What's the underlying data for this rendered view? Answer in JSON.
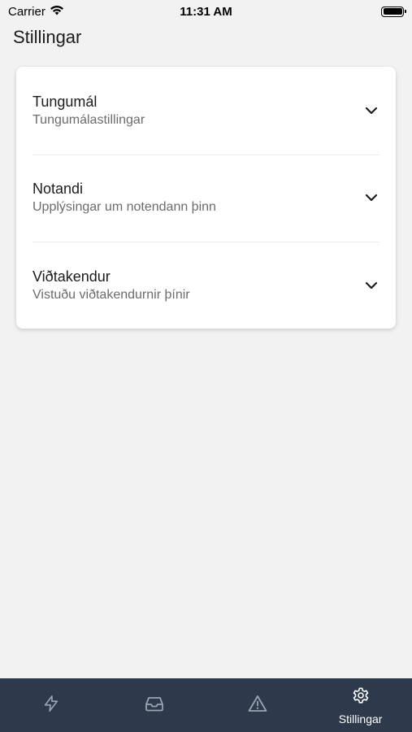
{
  "status_bar": {
    "carrier": "Carrier",
    "time": "11:31 AM"
  },
  "header": {
    "title": "Stillingar"
  },
  "settings": {
    "items": [
      {
        "title": "Tungumál",
        "subtitle": "Tungumálastillingar",
        "icon": "chevron-down-icon"
      },
      {
        "title": "Notandi",
        "subtitle": "Upplýsingar um notendann þinn",
        "icon": "chevron-down-icon"
      },
      {
        "title": "Viðtakendur",
        "subtitle": "Vistuðu viðtakendurnir þínir",
        "icon": "chevron-down-icon"
      }
    ]
  },
  "tab_bar": {
    "tabs": [
      {
        "icon": "lightning-icon",
        "label": ""
      },
      {
        "icon": "inbox-icon",
        "label": ""
      },
      {
        "icon": "warning-icon",
        "label": ""
      },
      {
        "icon": "gear-icon",
        "label": "Stillingar",
        "active": true
      }
    ]
  },
  "colors": {
    "background": "#f2f2f2",
    "tab_bar": "#2c3a4b",
    "card": "#ffffff",
    "subtitle": "#6b6b70"
  }
}
